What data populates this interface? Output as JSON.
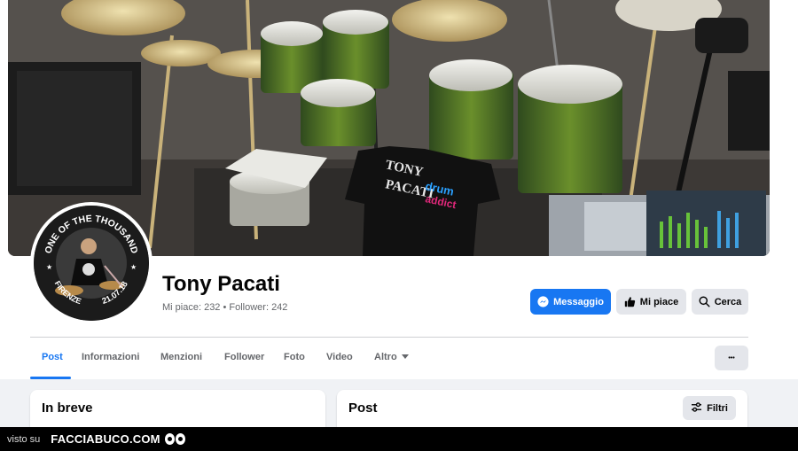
{
  "profile": {
    "name": "Tony Pacati",
    "stats": "Mi piace: 232 • Follower: 242",
    "avatar_badge": {
      "top_text": "ONE OF THE THOUSAND",
      "left_text": "FIRENZE",
      "right_text": "21.07.18"
    },
    "cover_shirt_text": [
      "TONY",
      "PACATI",
      "drum",
      "addict"
    ]
  },
  "actions": {
    "message_label": "Messaggio",
    "like_label": "Mi piace",
    "search_label": "Cerca",
    "more_label": "•••"
  },
  "tabs": [
    {
      "label": "Post",
      "active": true
    },
    {
      "label": "Informazioni",
      "active": false
    },
    {
      "label": "Menzioni",
      "active": false
    },
    {
      "label": "Follower",
      "active": false
    },
    {
      "label": "Foto",
      "active": false
    },
    {
      "label": "Video",
      "active": false
    },
    {
      "label": "Altro",
      "active": false
    }
  ],
  "cards": {
    "intro_title": "In breve",
    "posts_title": "Post",
    "filters_label": "Filtri"
  },
  "watermark": {
    "prefix": "visto su",
    "brand": "FACCIABUCO.COM"
  },
  "colors": {
    "accent": "#1877f2",
    "button_gray": "#e4e6eb",
    "page_bg": "#f0f2f5"
  }
}
